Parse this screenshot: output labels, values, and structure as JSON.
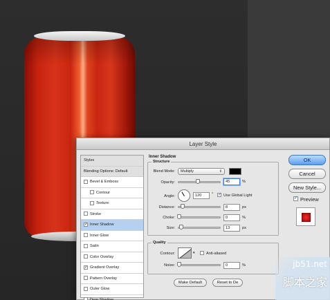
{
  "dialog": {
    "title": "Layer Style"
  },
  "styles_list": {
    "header": "Styles",
    "blending_options": "Blending Options: Default",
    "items": [
      {
        "label": "Bevel & Emboss",
        "checked": false,
        "sub": false,
        "selected": false
      },
      {
        "label": "Contour",
        "checked": false,
        "sub": true,
        "selected": false
      },
      {
        "label": "Texture",
        "checked": false,
        "sub": true,
        "selected": false
      },
      {
        "label": "Stroke",
        "checked": false,
        "sub": false,
        "selected": false
      },
      {
        "label": "Inner Shadow",
        "checked": true,
        "sub": false,
        "selected": true
      },
      {
        "label": "Inner Glow",
        "checked": false,
        "sub": false,
        "selected": false
      },
      {
        "label": "Satin",
        "checked": false,
        "sub": false,
        "selected": false
      },
      {
        "label": "Color Overlay",
        "checked": false,
        "sub": false,
        "selected": false
      },
      {
        "label": "Gradient Overlay",
        "checked": true,
        "sub": false,
        "selected": false
      },
      {
        "label": "Pattern Overlay",
        "checked": false,
        "sub": false,
        "selected": false
      },
      {
        "label": "Outer Glow",
        "checked": false,
        "sub": false,
        "selected": false
      },
      {
        "label": "Drop Shadow",
        "checked": false,
        "sub": false,
        "selected": false
      }
    ]
  },
  "inner_shadow": {
    "title": "Inner Shadow",
    "structure": {
      "title": "Structure",
      "blend_mode_label": "Blend Mode:",
      "blend_mode_value": "Multiply",
      "shadow_color": "#000000",
      "opacity_label": "Opacity:",
      "opacity_value": "45",
      "opacity_fraction": 0.45,
      "angle_label": "Angle:",
      "angle_value": "120",
      "degree_symbol": "°",
      "use_global_light_label": "Use Global Light",
      "use_global_light_checked": true,
      "distance_label": "Distance:",
      "distance_value": "8",
      "choke_label": "Choke:",
      "choke_value": "0",
      "size_label": "Size:",
      "size_value": "13",
      "percent_unit": "%",
      "px_unit": "px"
    },
    "quality": {
      "title": "Quality",
      "contour_label": "Contour:",
      "anti_aliased_label": "Anti-aliased",
      "anti_aliased_checked": false,
      "noise_label": "Noise:",
      "noise_value": "0",
      "percent_unit": "%"
    },
    "make_default_label": "Make Default",
    "reset_default_label": "Reset to De"
  },
  "buttons": {
    "ok": "OK",
    "cancel": "Cancel",
    "new_style": "New Style...",
    "preview": "Preview",
    "preview_checked": true
  },
  "watermark": {
    "line1": "jb51.net",
    "line2": "脚本之家"
  }
}
